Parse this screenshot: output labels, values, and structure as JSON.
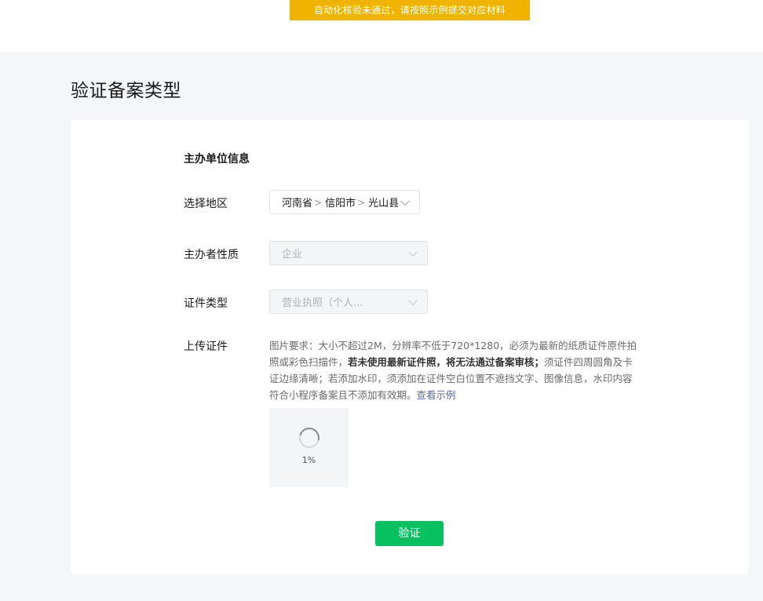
{
  "banner": {
    "text": "自动化核验未通过，请按照示例提交对应材料",
    "color": "#f0b400"
  },
  "page": {
    "title": "验证备案类型"
  },
  "form": {
    "section_title": "主办单位信息",
    "region": {
      "label": "选择地区",
      "province": "河南省",
      "city": "信阳市",
      "county": "光山县",
      "separator": ">",
      "icon": "chevron-down-icon"
    },
    "nature": {
      "label": "主办者性质",
      "value": "企业",
      "disabled": true,
      "icon": "chevron-down-icon"
    },
    "cert_type": {
      "label": "证件类型",
      "value": "营业执照（个人...",
      "disabled": true,
      "icon": "chevron-down-icon"
    },
    "upload": {
      "label": "上传证件",
      "desc_part1": "图片要求：大小不超过2M，分辨率不低于720*1280，必须为最新的纸质证件原件拍照或彩色扫描件，",
      "desc_bold": "若未使用最新证件照，将无法通过备案审核；",
      "desc_part2": "须证件四周圆角及卡证边缘清晰；若添加水印，须添加在证件空白位置不遮挡文字、图像信息，水印内容符合小程序备案且不添加有效期。",
      "example_link": "查看示例",
      "progress": "1%",
      "progress_value": 0.01,
      "icon": "loading-spinner-icon"
    },
    "submit_label": "验证",
    "submit_color": "#07c160"
  }
}
